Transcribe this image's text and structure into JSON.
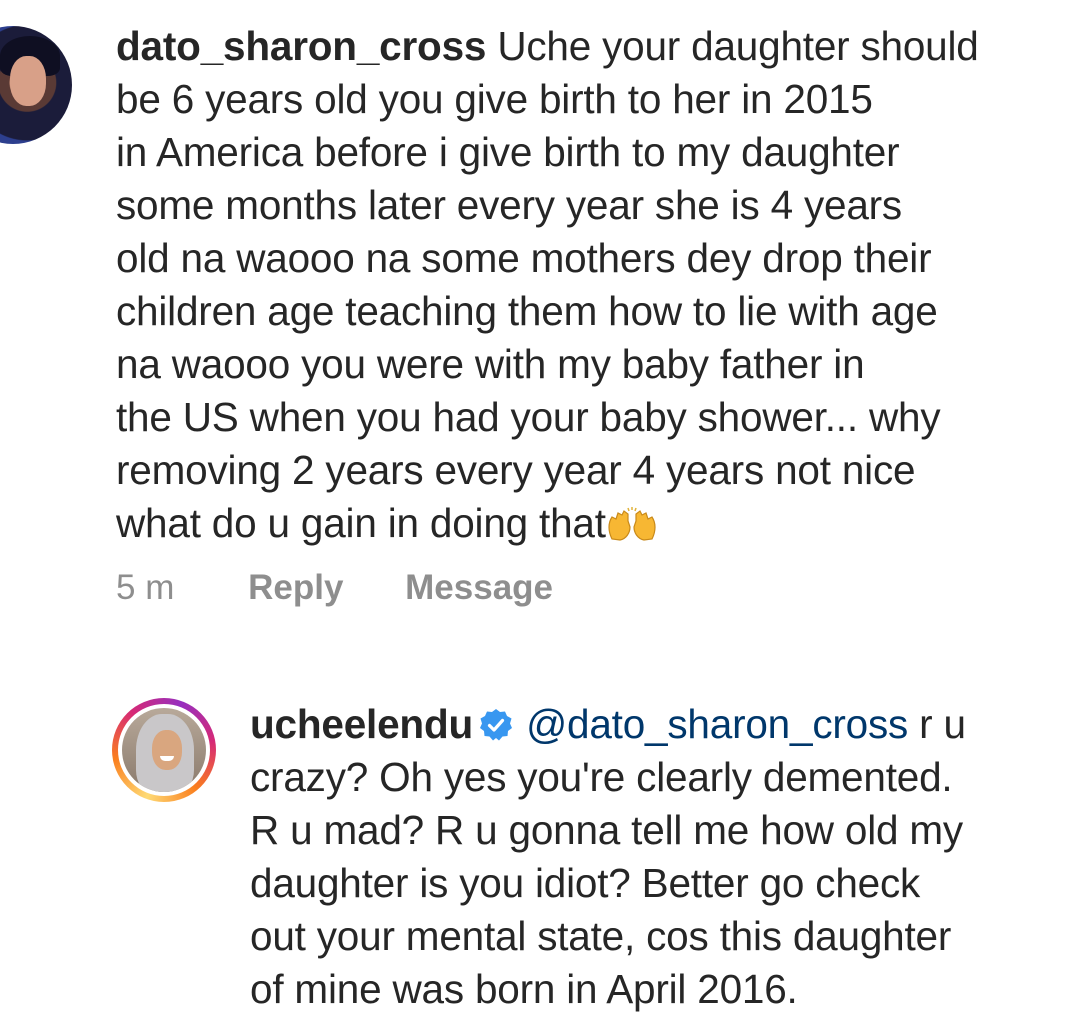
{
  "comments": [
    {
      "username": "dato_sharon_cross",
      "lines": [
        "Uche your daughter should",
        "be 6 years old you give birth to her in 2015",
        "in America before i give birth to my daughter",
        "some months later every year she is 4 years",
        "old na waooo na some mothers dey drop their",
        "children age teaching them how to lie with age",
        "na waooo you were with my baby father in",
        "the US when you had your baby shower... why",
        "removing 2 years every year 4 years not nice",
        "what do u gain in doing that"
      ],
      "emoji_icon": "raising-hands-icon",
      "time": "5 m",
      "reply_label": "Reply",
      "message_label": "Message"
    },
    {
      "username": "ucheelendu",
      "verified_icon": "verified-badge-icon",
      "mention": "@dato_sharon_cross",
      "first_line_rest": " r u",
      "lines": [
        "crazy? Oh yes you're clearly demented.",
        "R u mad? R u gonna tell me how old my",
        "daughter is you idiot? Better go check",
        "out your mental state, cos this daughter",
        "of mine was born in April 2016."
      ]
    }
  ],
  "colors": {
    "text": "#262626",
    "secondary": "#8e8e8e",
    "mention": "#00376b",
    "verified": "#3897f0"
  }
}
